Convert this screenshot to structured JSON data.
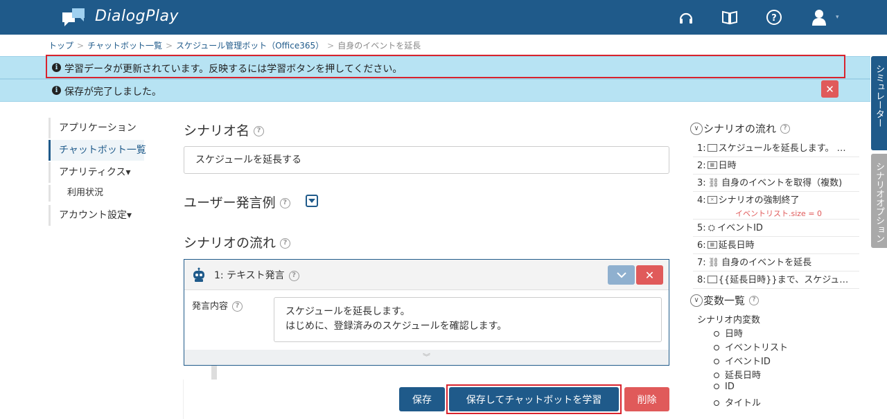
{
  "app": {
    "name": "DialogPlay"
  },
  "breadcrumb": [
    "トップ",
    "チャットボット一覧",
    "スケジュール管理ボット（Office365）",
    "自身のイベントを延長"
  ],
  "alerts": {
    "learn_notice": "学習データが更新されています。反映するには学習ボタンを押してください。",
    "saved_notice": "保存が完了しました。"
  },
  "side_tabs": {
    "simulator": "シミュレーター",
    "scenario_option": "シナリオオプション"
  },
  "nav": {
    "items": [
      "アプリケーション",
      "チャットボット一覧",
      "アナリティクス▾",
      "利用状況",
      "アカウント設定▾"
    ]
  },
  "main": {
    "scenario_name_label": "シナリオ名",
    "scenario_name_value": "スケジュールを延長する",
    "user_utterance_label": "ユーザー発言例",
    "flow_label": "シナリオの流れ",
    "card": {
      "title": "1: テキスト発言",
      "field_label": "発言内容",
      "text_line1": "スケジュールを延長します。",
      "text_line2": "はじめに、登録済みのスケジュールを確認します。"
    },
    "buttons": {
      "save": "保存",
      "save_learn": "保存してチャットボットを学習",
      "delete": "削除"
    }
  },
  "right_panel": {
    "flow_title": "シナリオの流れ",
    "flow": [
      {
        "num": "1:",
        "icon": "speech-icon",
        "text": "スケジュールを延長します。 …"
      },
      {
        "num": "2:",
        "icon": "calendar-icon",
        "text": "日時"
      },
      {
        "num": "3:",
        "icon": "link-icon",
        "text": "自身のイベントを取得（複数)"
      },
      {
        "num": "4:",
        "icon": "stop-icon",
        "text": "シナリオの強制終了"
      },
      {
        "num": "5:",
        "icon": "badge-icon",
        "text": "イベントID"
      },
      {
        "num": "6:",
        "icon": "calendar-icon",
        "text": "延長日時"
      },
      {
        "num": "7:",
        "icon": "link-icon",
        "text": "自身のイベントを延長"
      },
      {
        "num": "8:",
        "icon": "speech-icon",
        "text": "{{延長日時}}まで、スケジュ…"
      }
    ],
    "flow_condition": "イベントリスト.size = 0",
    "vars_title": "変数一覧",
    "vars_subtitle": "シナリオ内変数",
    "vars": [
      "日時",
      "イベントリスト",
      "イベントID",
      "延長日時",
      "ID",
      "タイトル"
    ]
  },
  "colors": {
    "brand": "#1f5a8a",
    "alert_bg": "#b7e3f3",
    "danger": "#e05a5a",
    "highlight": "#d9232d"
  }
}
